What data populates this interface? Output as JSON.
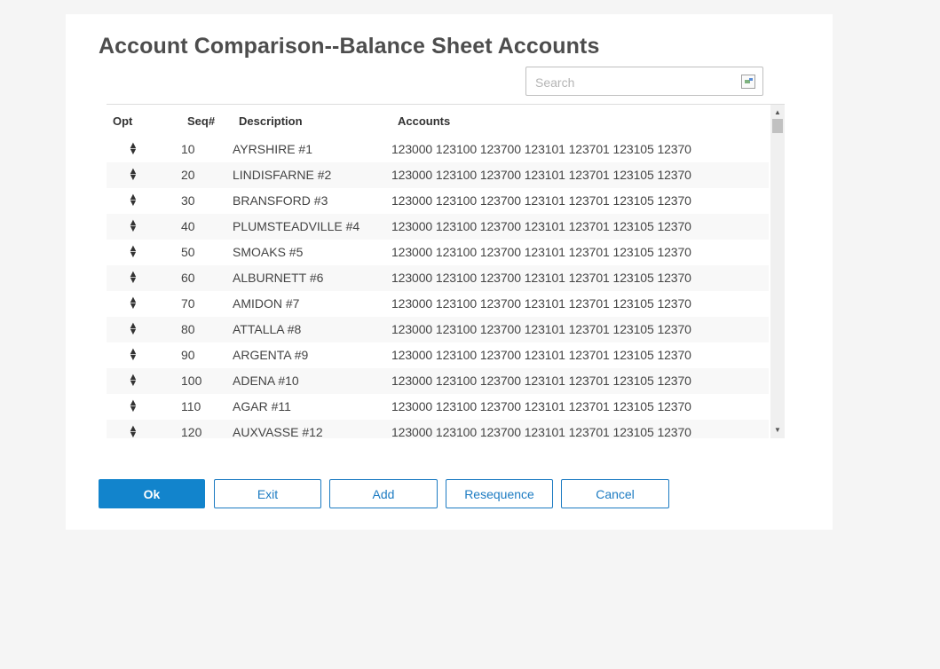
{
  "dialog": {
    "title": "Account Comparison--Balance Sheet Accounts",
    "search_placeholder": "Search"
  },
  "grid": {
    "headers": {
      "opt": "Opt",
      "seq": "Seq#",
      "description": "Description",
      "accounts": "Accounts"
    },
    "rows": [
      {
        "seq": "10",
        "description": "AYRSHIRE #1",
        "accounts": "123000 123100 123700 123101 123701 123105 12370"
      },
      {
        "seq": "20",
        "description": "LINDISFARNE #2",
        "accounts": "123000 123100 123700 123101 123701 123105 12370"
      },
      {
        "seq": "30",
        "description": "BRANSFORD #3",
        "accounts": "123000 123100 123700 123101 123701 123105 12370"
      },
      {
        "seq": "40",
        "description": "PLUMSTEADVILLE #4",
        "accounts": "123000 123100 123700 123101 123701 123105 12370"
      },
      {
        "seq": "50",
        "description": "SMOAKS #5",
        "accounts": "123000 123100 123700 123101 123701 123105 12370"
      },
      {
        "seq": "60",
        "description": "ALBURNETT #6",
        "accounts": "123000 123100 123700 123101 123701 123105 12370"
      },
      {
        "seq": "70",
        "description": "AMIDON #7",
        "accounts": "123000 123100 123700 123101 123701 123105 12370"
      },
      {
        "seq": "80",
        "description": "ATTALLA #8",
        "accounts": "123000 123100 123700 123101 123701 123105 12370"
      },
      {
        "seq": "90",
        "description": "ARGENTA #9",
        "accounts": "123000 123100 123700 123101 123701 123105 12370"
      },
      {
        "seq": "100",
        "description": "ADENA #10",
        "accounts": "123000 123100 123700 123101 123701 123105 12370"
      },
      {
        "seq": "110",
        "description": "AGAR #11",
        "accounts": "123000 123100 123700 123101 123701 123105 12370"
      },
      {
        "seq": "120",
        "description": "AUXVASSE #12",
        "accounts": "123000 123100 123700 123101 123701 123105 12370"
      }
    ]
  },
  "buttons": {
    "ok": "Ok",
    "exit": "Exit",
    "add": "Add",
    "resequence": "Resequence",
    "cancel": "Cancel"
  },
  "icons": {
    "opt": "sort-handle-icon",
    "search": "image-icon"
  },
  "colors": {
    "accent": "#1284cc",
    "title": "#4d4d4d"
  }
}
